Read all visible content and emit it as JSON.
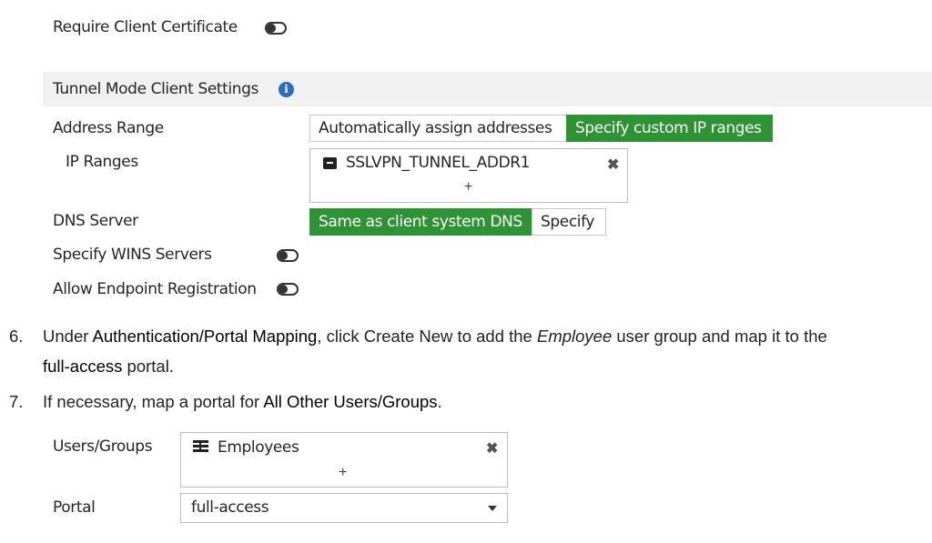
{
  "top": {
    "require_cert_label": "Require Client Certificate",
    "require_cert_on": false
  },
  "tunnel": {
    "section_title": "Tunnel Mode Client Settings",
    "address_range_label": "Address Range",
    "address_options": [
      "Automatically assign addresses",
      "Specify custom IP ranges"
    ],
    "address_selected": "Specify custom IP ranges",
    "ip_ranges_label": "IP Ranges",
    "ip_range_item": "SSLVPN_TUNNEL_ADDR1",
    "add_symbol": "+",
    "remove_symbol": "✖",
    "dns_label": "DNS Server",
    "dns_options": [
      "Same as client system DNS",
      "Specify"
    ],
    "dns_selected": "Same as client system DNS",
    "wins_label": "Specify WINS Servers",
    "wins_on": false,
    "endpoint_label": "Allow Endpoint Registration",
    "endpoint_on": false
  },
  "steps": [
    {
      "num": "6.",
      "line1_parts": [
        "Under ",
        "Authentication/Portal Mapping",
        ", click Create New to add the ",
        "Employee",
        " user group and map it to the"
      ],
      "line2_parts": [
        "full-access",
        " portal."
      ]
    },
    {
      "num": "7.",
      "parts": [
        "If necessary, map a portal for ",
        "All Other Users/Groups",
        "."
      ]
    }
  ],
  "mapping": {
    "users_label": "Users/Groups",
    "users_item": "Employees",
    "add_symbol": "+",
    "remove_symbol": "✖",
    "portal_label": "Portal",
    "portal_value": "full-access"
  },
  "colors": {
    "accent_green": "#2d9335",
    "info_blue": "#2a6dbd",
    "section_bg": "#f1f1f1"
  }
}
